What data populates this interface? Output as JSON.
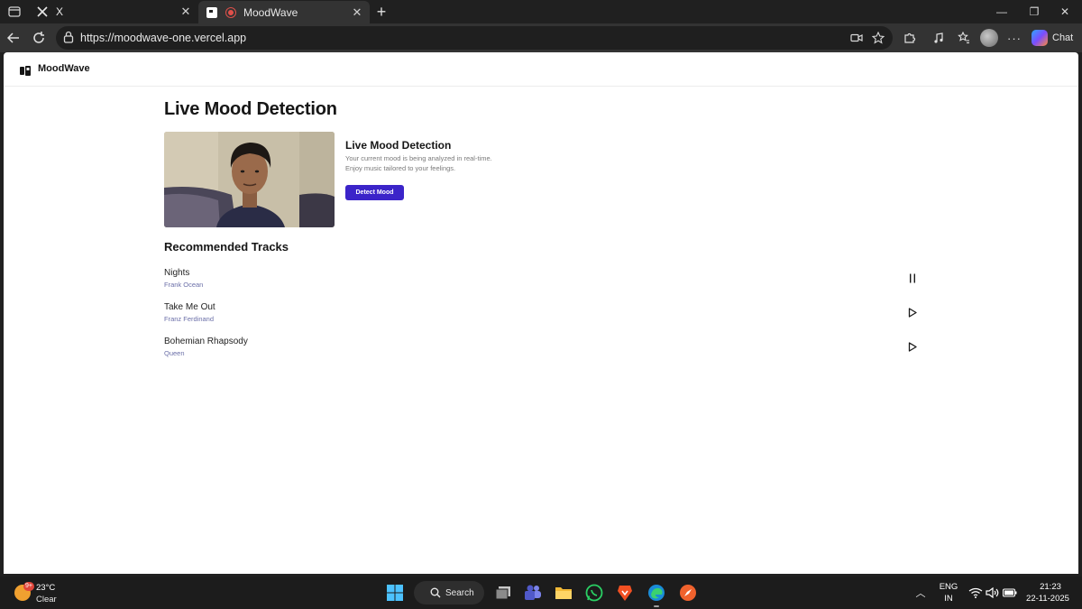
{
  "browser": {
    "tabs": [
      {
        "title": "X",
        "favicon": "x-logo-icon"
      },
      {
        "title": "MoodWave",
        "favicon": "moodwave-logo-icon",
        "recording": true
      }
    ],
    "url": "https://moodwave-one.vercel.app",
    "chat_label": "Chat"
  },
  "app": {
    "brand": "MoodWave",
    "page_title": "Live Mood Detection",
    "detection": {
      "title": "Live Mood Detection",
      "description_line1": "Your current mood is being analyzed in real-time.",
      "description_line2": "Enjoy music tailored to your feelings.",
      "button_label": "Detect Mood"
    },
    "recommended_title": "Recommended Tracks",
    "tracks": [
      {
        "name": "Nights",
        "artist": "Frank Ocean",
        "state": "playing",
        "control_icon": "pause-icon"
      },
      {
        "name": "Take Me Out",
        "artist": "Franz Ferdinand",
        "state": "paused",
        "control_icon": "play-icon"
      },
      {
        "name": "Bohemian Rhapsody",
        "artist": "Queen",
        "state": "paused",
        "control_icon": "play-icon"
      }
    ],
    "colors": {
      "accent": "#3b24c9",
      "artist": "#6b6fa8"
    }
  },
  "taskbar": {
    "weather": {
      "temp": "23°C",
      "condition": "Clear",
      "badge": "9+"
    },
    "search_label": "Search",
    "lang_top": "ENG",
    "lang_bottom": "IN",
    "time": "21:23",
    "date": "22-11-2025"
  }
}
